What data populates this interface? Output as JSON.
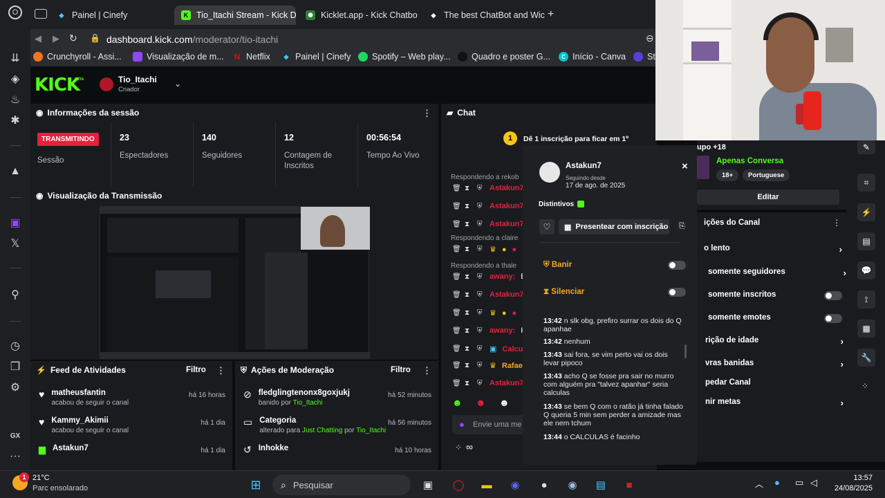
{
  "browser": {
    "tabs": [
      {
        "label": "Painel | Cinefy",
        "active": false
      },
      {
        "label": "Tio_Itachi Stream - Kick D",
        "active": true
      },
      {
        "label": "Kicklet.app - Kick Chatbo",
        "active": false
      },
      {
        "label": "The best ChatBot and Wic",
        "active": false
      }
    ],
    "address": {
      "domain": "dashboard.kick.com",
      "path": "/moderator/tio-itachi"
    },
    "bookmarks": [
      "Crunchyroll - Assi...",
      "Visualização de m...",
      "Netflix",
      "Painel | Cinefy",
      "Spotify – Web play...",
      "Quadro e poster G...",
      "Início - Canva",
      "St"
    ]
  },
  "kick": {
    "logo": "KICK",
    "beta": "BETA",
    "channel": {
      "name": "Tio_Itachi",
      "role": "Criador"
    },
    "session": {
      "title": "Informações da sessão",
      "status_badge": "TRANSMITINDO",
      "status_label": "Sessão",
      "viewers": {
        "value": "23",
        "label": "Espectadores"
      },
      "followers": {
        "value": "140",
        "label": "Seguidores"
      },
      "subs": {
        "value": "12",
        "label": "Contagem de Inscritos"
      },
      "live_time": {
        "value": "00:56:54",
        "label": "Tempo Ao Vivo"
      }
    },
    "preview": {
      "title": "Visualização da Transmissão"
    },
    "activity": {
      "title": "Feed de Atividades",
      "filter": "Filtro",
      "items": [
        {
          "user": "matheusfantin",
          "text": "acabou de seguir o canal",
          "time": "há 16 horas"
        },
        {
          "user": "Kammy_Akimii",
          "text": "acabou de seguir o canal",
          "time": "há 1 dia"
        },
        {
          "user": "Astakun7",
          "text": "",
          "time": "há 1 dia"
        }
      ]
    },
    "moderation": {
      "title": "Ações de Moderação",
      "filter": "Filtro",
      "items": [
        {
          "title": "fledglingtenonx8goxjukj",
          "pre": "banido por",
          "by": "Tio_Itachi",
          "time": "há 52 minutos"
        },
        {
          "title": "Categoria",
          "pre": "alterado para",
          "category": "Just Chatting",
          "mid": "por",
          "by": "Tio_Itachi",
          "time": "há 56 minutos"
        },
        {
          "title": "Inhokke",
          "time": "há 10 horas"
        }
      ]
    },
    "chat": {
      "title": "Chat",
      "banner": "Dê 1 inscrição para ficar em 1º",
      "banner_badge": "1",
      "replies": [
        "Respondendo a rekob",
        "Respondendo a claire",
        "Respondendo a thale"
      ],
      "rows": [
        {
          "name": "Astakun7:",
          "text": ""
        },
        {
          "name": "Astakun7:",
          "text": ""
        },
        {
          "name": "Astakun7:",
          "text": ""
        },
        {
          "name": "",
          "text": ""
        },
        {
          "name": "awany:",
          "text": "Bo"
        },
        {
          "name": "Astakun7:",
          "text": ""
        },
        {
          "name": "",
          "text": ""
        },
        {
          "name": "awany:",
          "text": "KK"
        },
        {
          "name": "Calculi",
          "text": ""
        },
        {
          "name": "Rafaela",
          "text": ""
        },
        {
          "name": "Astakun7:",
          "text": ""
        }
      ],
      "input_placeholder": "Envie uma me"
    },
    "user_card": {
      "username": "Astakun7",
      "following_label": "Seguindo desde",
      "following_date": "17 de ago. de 2025",
      "badges_label": "Distintivos",
      "gift_button": "Presentear com inscrição",
      "ban_label": "Banir",
      "mute_label": "Silenciar",
      "messages": [
        {
          "time": "13:42",
          "text": "n slk obg, prefiro surrar os dois do Q apanhae"
        },
        {
          "time": "13:42",
          "text": "nenhum"
        },
        {
          "time": "13:43",
          "text": "sai fora, se vim perto vai os dois levar pipoco"
        },
        {
          "time": "13:43",
          "text": "acho Q se fosse pra sair no murro com alguém pra \"talvez apanhar\" seria calculas"
        },
        {
          "time": "13:43",
          "text": "se bem Q com o ratão já tinha falado Q queria 5 min sem perder a amizade mas ele nem tchum"
        },
        {
          "time": "13:44",
          "text": "o CALCULAS é facinho"
        }
      ]
    },
    "stream_info": {
      "category_label": "upo +18",
      "title_label": "Apenas Conversa",
      "tags": [
        "18+",
        "Portuguese"
      ],
      "edit_button": "Editar"
    },
    "channel_actions": {
      "title": "ições do Canal",
      "items": [
        {
          "label": "o lento",
          "control": "chevron"
        },
        {
          "label": "somente seguidores",
          "control": "chevron"
        },
        {
          "label": "somente inscritos",
          "control": "toggle"
        },
        {
          "label": "somente emotes",
          "control": "toggle"
        },
        {
          "label": "rição de idade",
          "control": "chevron"
        },
        {
          "label": "vras banidas",
          "control": "chevron"
        },
        {
          "label": "pedar Canal",
          "control": "none"
        },
        {
          "label": "nir metas",
          "control": "chevron"
        }
      ]
    }
  },
  "taskbar": {
    "weather_temp": "21°C",
    "weather_desc": "Parc ensolarado",
    "weather_badge": "1",
    "search_placeholder": "Pesquisar",
    "time": "13:57",
    "date": "24/08/2025"
  },
  "colors": {
    "kick_green": "#53fc18",
    "live_red": "#e5213c",
    "panel": "#191b1f"
  }
}
